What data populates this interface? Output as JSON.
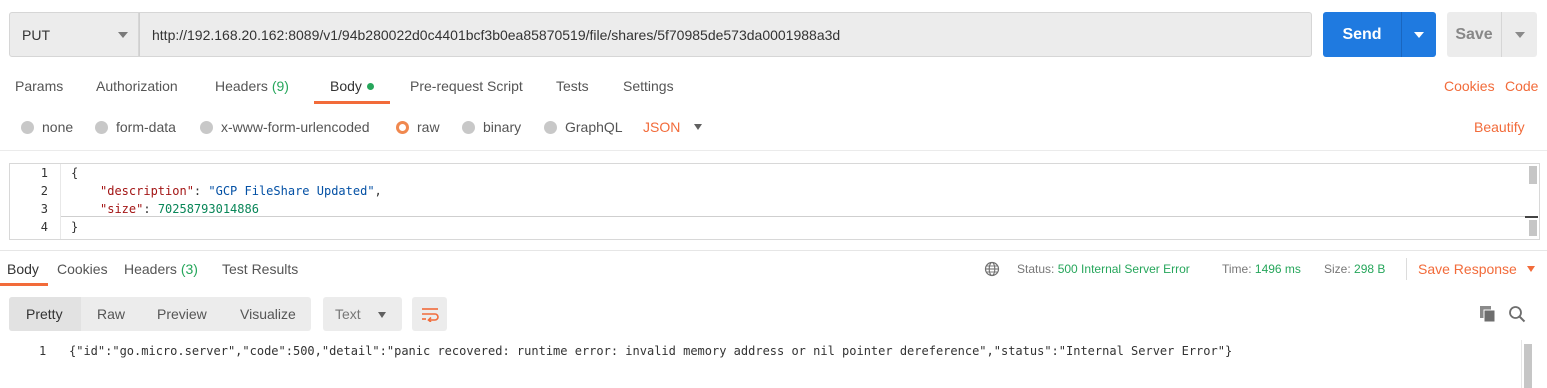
{
  "request": {
    "method": "PUT",
    "url": "http://192.168.20.162:8089/v1/94b280022d0c4401bcf3b0ea85870519/file/shares/5f70985de573da0001988a3d",
    "send_label": "Send",
    "save_label": "Save"
  },
  "request_tabs": {
    "params": "Params",
    "authorization": "Authorization",
    "headers": "Headers",
    "headers_count": "(9)",
    "body": "Body",
    "prerequest": "Pre-request Script",
    "tests": "Tests",
    "settings": "Settings",
    "cookies": "Cookies",
    "code": "Code"
  },
  "body_types": {
    "none": "none",
    "form_data": "form-data",
    "urlencoded": "x-www-form-urlencoded",
    "raw": "raw",
    "binary": "binary",
    "graphql": "GraphQL",
    "selected": "raw",
    "format": "JSON",
    "beautify": "Beautify"
  },
  "editor": {
    "line_numbers": [
      "1",
      "2",
      "3",
      "4"
    ],
    "open_brace": "{",
    "close_brace": "}",
    "desc_key": "\"description\"",
    "desc_value": "\"GCP FileShare Updated\"",
    "size_key": "\"size\"",
    "size_value": "70258793014886"
  },
  "response_tabs": {
    "body": "Body",
    "cookies": "Cookies",
    "headers": "Headers",
    "headers_count": "(3)",
    "test_results": "Test Results"
  },
  "response_meta": {
    "status_label": "Status:",
    "status_value": "500 Internal Server Error",
    "time_label": "Time:",
    "time_value": "1496 ms",
    "size_label": "Size:",
    "size_value": "298 B",
    "save_response": "Save Response"
  },
  "response_view": {
    "pretty": "Pretty",
    "raw": "Raw",
    "preview": "Preview",
    "visualize": "Visualize",
    "format": "Text"
  },
  "response_body": {
    "line_number": "1",
    "text": "{\"id\":\"go.micro.server\",\"code\":500,\"detail\":\"panic recovered: runtime error: invalid memory address or nil pointer dereference\",\"status\":\"Internal Server Error\"}"
  },
  "colors": {
    "accent": "#f26b3a",
    "send": "#1f7ae0",
    "success": "#26a65b"
  },
  "icons": [
    "chevron-down-icon",
    "globe-icon",
    "wrap-lines-icon",
    "copy-icon",
    "search-icon"
  ]
}
